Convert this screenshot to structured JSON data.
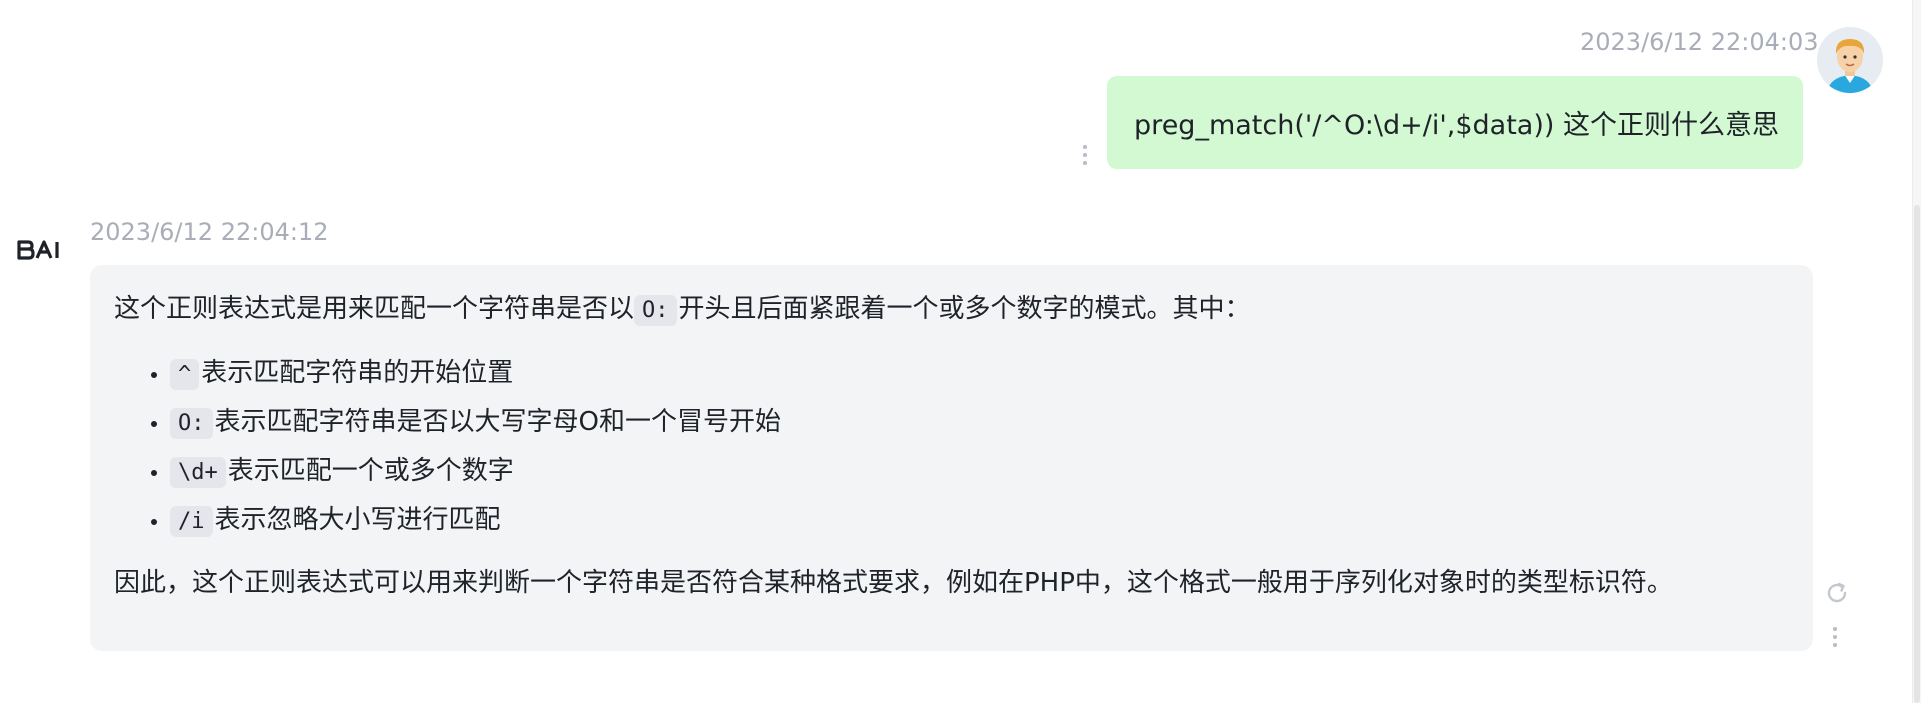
{
  "user_message": {
    "timestamp": "2023/6/12 22:04:03",
    "text": "preg_match('/^O:\\d+/i',$data)) 这个正则什么意思"
  },
  "ai_message": {
    "logo_text": "BAI",
    "timestamp": "2023/6/12 22:04:12",
    "intro": {
      "before": "这个正则表达式是用来匹配一个字符串是否以",
      "code": "O:",
      "after": "开头且后面紧跟着一个或多个数字的模式。其中："
    },
    "items": [
      {
        "code": "^",
        "text": "表示匹配字符串的开始位置"
      },
      {
        "code": "O:",
        "text": "表示匹配字符串是否以大写字母O和一个冒号开始"
      },
      {
        "code": "\\d+",
        "text": "表示匹配一个或多个数字"
      },
      {
        "code": "/i",
        "text": "表示忽略大小写进行匹配"
      }
    ],
    "conclusion": "因此，这个正则表达式可以用来判断一个字符串是否符合某种格式要求，例如在PHP中，这个格式一般用于序列化对象时的类型标识符。"
  },
  "icons": {
    "user_avatar": "user-avatar-illustration",
    "user_more": "vertical-dots-icon",
    "ai_more": "vertical-dots-icon",
    "regenerate": "refresh-icon"
  },
  "colors": {
    "user_bubble": "#d2f9d1",
    "ai_bubble": "#f3f4f6",
    "timestamp": "#a8adb7",
    "code_bg": "#e4e6eb"
  }
}
